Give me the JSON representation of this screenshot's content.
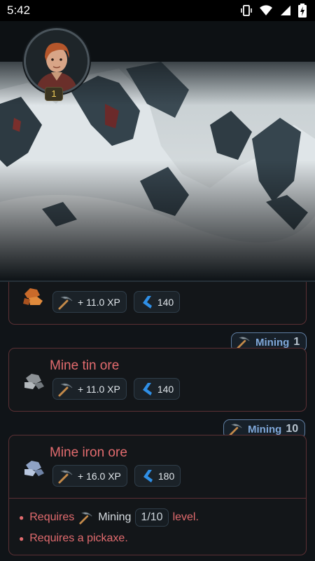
{
  "status_bar": {
    "time": "5:42",
    "icons": [
      "vibrate-icon",
      "wifi-icon",
      "signal-icon",
      "battery-charging-icon"
    ]
  },
  "player": {
    "level": "1"
  },
  "cards": [
    {
      "title": "",
      "ore": "copper-ore-icon",
      "xp": "+ 11.0 XP",
      "gold": "140"
    },
    {
      "title": "Mine tin ore",
      "ore": "tin-ore-icon",
      "xp": "+ 11.0 XP",
      "gold": "140",
      "requirement": {
        "skill": "Mining",
        "level": "1"
      }
    },
    {
      "title": "Mine iron ore",
      "ore": "iron-ore-icon",
      "xp": "+ 16.0 XP",
      "gold": "180",
      "requirement": {
        "skill": "Mining",
        "level": "10"
      },
      "unmet": {
        "line1_prefix": "Requires",
        "line1_skill": "Mining",
        "line1_progress": "1/10",
        "line1_suffix": "level.",
        "line2": "Requires a pickaxe."
      }
    }
  ],
  "colors": {
    "accent_red": "#e26b6e",
    "tag_blue": "#7fa7d9",
    "level_gold": "#f2cf5a"
  }
}
